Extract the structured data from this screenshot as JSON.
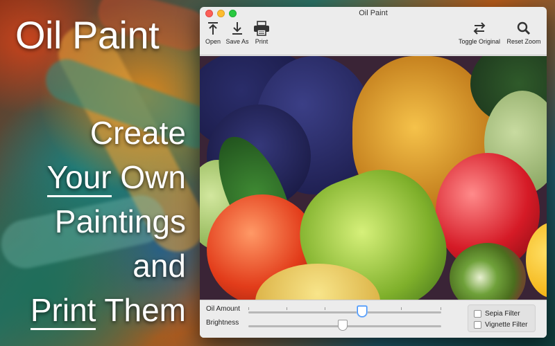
{
  "promo": {
    "title": "Oil Paint",
    "line1": "Create",
    "line2a": "Your",
    "line2b": " Own",
    "line3": "Paintings",
    "line4": "and",
    "line5a": "Print",
    "line5b": " Them"
  },
  "window": {
    "title": "Oil Paint"
  },
  "toolbar": {
    "open_label": "Open",
    "saveas_label": "Save As",
    "print_label": "Print",
    "toggle_label": "Toggle Original",
    "reset_label": "Reset Zoom",
    "icons": [
      "upload-icon",
      "download-icon",
      "printer-icon",
      "swap-arrows-icon",
      "magnifier-icon"
    ]
  },
  "controls": {
    "oil_amount_label": "Oil Amount",
    "brightness_label": "Brightness",
    "oil_amount_value": 0.59,
    "brightness_value": 0.49,
    "sepia_label": "Sepia Filter",
    "vignette_label": "Vignette Filter",
    "sepia_checked": false,
    "vignette_checked": false
  },
  "colors": {
    "accent": "#3d8ef7",
    "window_bg": "#ececec"
  }
}
